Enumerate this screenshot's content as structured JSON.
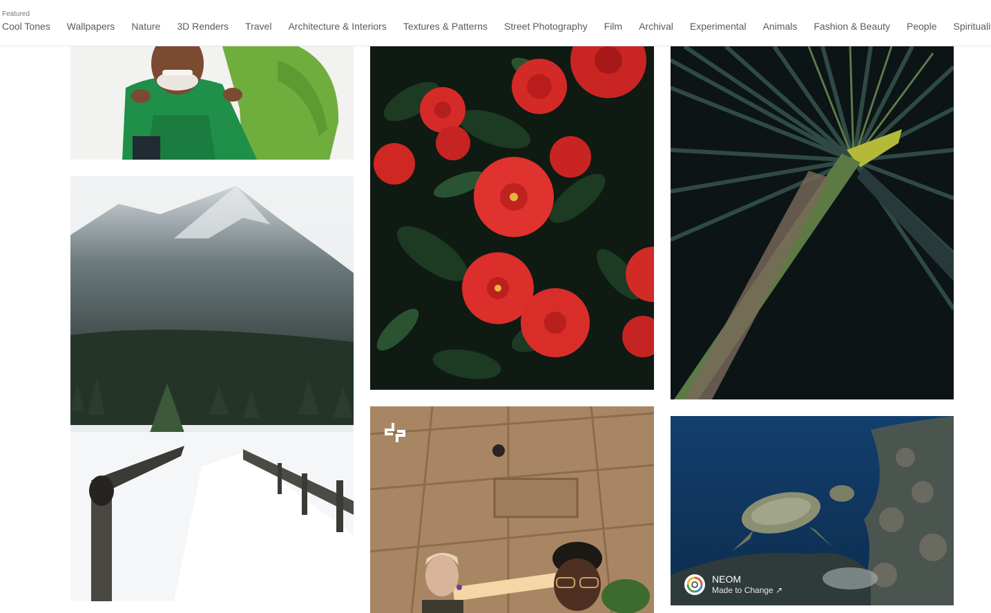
{
  "topnav": {
    "featured_label": "Featured",
    "items": [
      "Cool Tones",
      "Wallpapers",
      "Nature",
      "3D Renders",
      "Travel",
      "Architecture & Interiors",
      "Textures & Patterns",
      "Street Photography",
      "Film",
      "Archival",
      "Experimental",
      "Animals",
      "Fashion & Beauty",
      "People",
      "Spirituality"
    ]
  },
  "tiles": {
    "sponsor": {
      "name": "NEOM",
      "tagline": "Made to Change ↗"
    },
    "watermark_text": "Unsplash+"
  },
  "colors": {
    "nav_text": "#5a5a5a",
    "divider": "#e6e6e6"
  }
}
